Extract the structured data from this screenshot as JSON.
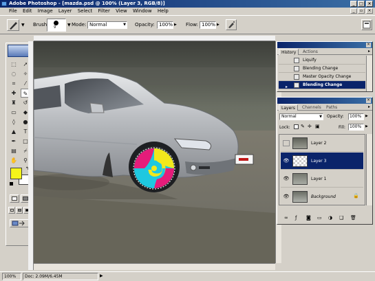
{
  "titlebar": {
    "title": "Adobe Photoshop - [mazda.psd @ 100% (Layer 3, RGB/8)]",
    "minimize": "_",
    "maximize": "□",
    "close": "×"
  },
  "menubar": {
    "items": [
      "File",
      "Edit",
      "Image",
      "Layer",
      "Select",
      "Filter",
      "View",
      "Window",
      "Help"
    ]
  },
  "options": {
    "brush_label": "Brush:",
    "brush_size": "9",
    "mode_label": "Mode:",
    "mode_value": "Normal",
    "opacity_label": "Opacity:",
    "opacity_value": "100%",
    "flow_label": "Flow:",
    "flow_value": "100%"
  },
  "toolbox": {
    "foreground_color": "#f5f51a",
    "background_color": "#ffffff"
  },
  "history_panel": {
    "tabs": [
      "History",
      "Actions"
    ],
    "items": [
      {
        "label": "Liquify",
        "selected": false
      },
      {
        "label": "Blending Change",
        "selected": false
      },
      {
        "label": "Master Opacity Change",
        "selected": false
      },
      {
        "label": "Blending Change",
        "selected": true
      }
    ]
  },
  "layers_panel": {
    "tabs": [
      "Layers",
      "Channels",
      "Paths"
    ],
    "blend_mode": "Normal",
    "opacity_label": "Opacity:",
    "opacity_value": "100%",
    "lock_label": "Lock:",
    "fill_label": "Fill:",
    "fill_value": "100%",
    "layers": [
      {
        "name": "Layer 2",
        "visible": false,
        "selected": false
      },
      {
        "name": "Layer 3",
        "visible": true,
        "selected": true
      },
      {
        "name": "Layer 1",
        "visible": true,
        "selected": false
      },
      {
        "name": "Background",
        "visible": true,
        "selected": false,
        "locked": true
      }
    ]
  },
  "statusbar": {
    "zoom": "100%",
    "doc": "Doc: 2.09M/6.45M"
  },
  "colors": {
    "titlebar": "#0a246a",
    "selection": "#0a246a",
    "chrome": "#d4d0c8"
  }
}
